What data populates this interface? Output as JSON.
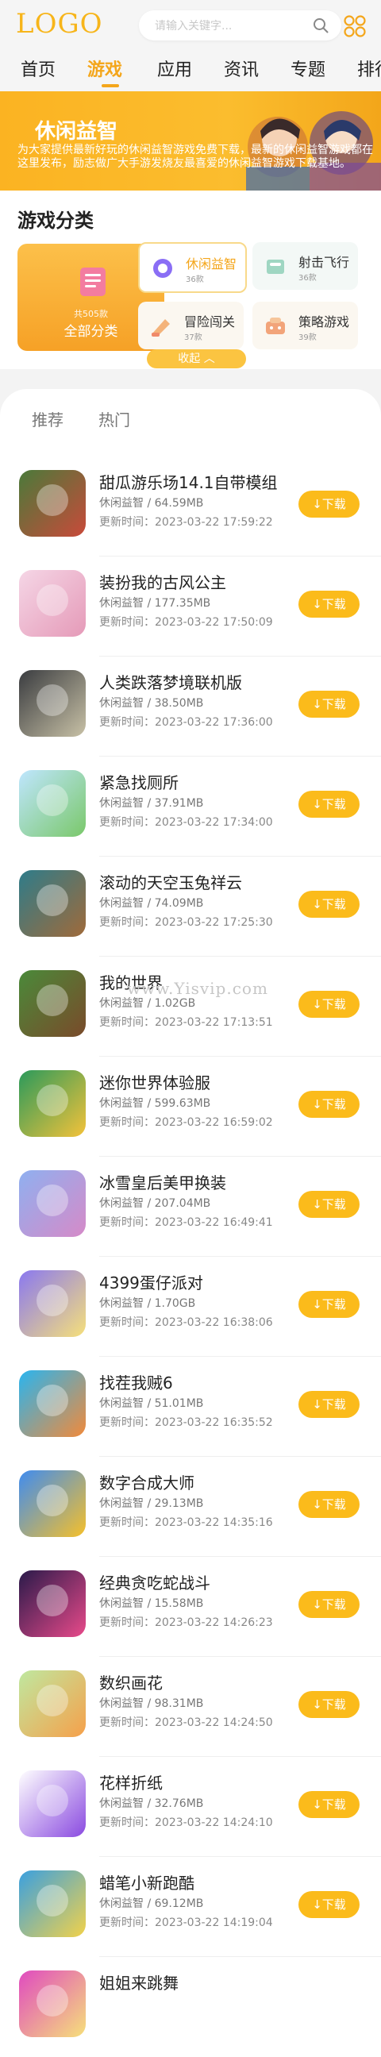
{
  "header": {
    "logo": "LOGO",
    "search_placeholder": "请输入关键字...",
    "nav": [
      "首页",
      "游戏",
      "应用",
      "资讯",
      "专题",
      "排行"
    ]
  },
  "banner": {
    "title": "休闲益智",
    "description": "为大家提供最新好玩的休闲益智游戏免费下载，最新的休闲益智游戏都在这里发布，励志做广大手游发烧友最喜爱的休闲益智游戏下载基地。"
  },
  "category_section": {
    "title": "游戏分类",
    "all": {
      "count": "共505款",
      "label": "全部分类"
    },
    "items": [
      {
        "label": "休闲益智",
        "count": "36款"
      },
      {
        "label": "射击飞行",
        "count": "36款"
      },
      {
        "label": "冒险闯关",
        "count": "37款"
      },
      {
        "label": "策略游戏",
        "count": "39款"
      }
    ],
    "collapse_label": "收起"
  },
  "tabs": [
    "推荐",
    "热门"
  ],
  "download_label": "↓下载",
  "watermark": "www.Yisvip.com",
  "games": [
    {
      "title": "甜瓜游乐场14.1自带模组",
      "meta": "休闲益智 / 64.59MB",
      "time": "更新时间：2023-03-22 17:59:22",
      "icon": "melon-playground-icon",
      "colors": [
        "#4a7a3a",
        "#c94a3a"
      ]
    },
    {
      "title": "装扮我的古风公主",
      "meta": "休闲益智 / 177.35MB",
      "time": "更新时间：2023-03-22 17:50:09",
      "icon": "princess-icon",
      "colors": [
        "#f5d6e6",
        "#e59ab8"
      ]
    },
    {
      "title": "人类跌落梦境联机版",
      "meta": "休闲益智 / 38.50MB",
      "time": "更新时间：2023-03-22 17:36:00",
      "icon": "human-fall-flat-icon",
      "colors": [
        "#3a3c40",
        "#c8c1a6"
      ]
    },
    {
      "title": "紧急找厕所",
      "meta": "休闲益智 / 37.91MB",
      "time": "更新时间：2023-03-22 17:34:00",
      "icon": "toilet-game-icon",
      "colors": [
        "#bfe6ff",
        "#7ac86a"
      ]
    },
    {
      "title": "滚动的天空玉兔祥云",
      "meta": "休闲益智 / 74.09MB",
      "time": "更新时间：2023-03-22 17:25:30",
      "icon": "rolling-sky-icon",
      "colors": [
        "#2e7c8a",
        "#a06a3a"
      ]
    },
    {
      "title": "我的世界",
      "meta": "休闲益智 / 1.02GB",
      "time": "更新时间：2023-03-22 17:13:51",
      "icon": "minecraft-icon",
      "colors": [
        "#4a8a3a",
        "#7a4a2a"
      ]
    },
    {
      "title": "迷你世界体验服",
      "meta": "休闲益智 / 599.63MB",
      "time": "更新时间：2023-03-22 16:59:02",
      "icon": "mini-world-icon",
      "colors": [
        "#2b9a5b",
        "#f4c23a"
      ]
    },
    {
      "title": "冰雪皇后美甲换装",
      "meta": "休闲益智 / 207.04MB",
      "time": "更新时间：2023-03-22 16:49:41",
      "icon": "ice-queen-icon",
      "colors": [
        "#8fb0f0",
        "#d68ac8"
      ]
    },
    {
      "title": "4399蛋仔派对",
      "meta": "休闲益智 / 1.70GB",
      "time": "更新时间：2023-03-22 16:38:06",
      "icon": "eggy-party-icon",
      "colors": [
        "#8a78f0",
        "#f6e07a"
      ]
    },
    {
      "title": "找茬我贼6",
      "meta": "休闲益智 / 51.01MB",
      "time": "更新时间：2023-03-22 16:35:52",
      "icon": "spot-difference-icon",
      "colors": [
        "#29b5f0",
        "#f28a3a"
      ]
    },
    {
      "title": "数字合成大师",
      "meta": "休闲益智 / 29.13MB",
      "time": "更新时间：2023-03-22 14:35:16",
      "icon": "number-merge-icon",
      "colors": [
        "#3f8cf0",
        "#f6c02a"
      ]
    },
    {
      "title": "经典贪吃蛇战斗",
      "meta": "休闲益智 / 15.58MB",
      "time": "更新时间：2023-03-22 14:26:23",
      "icon": "snake-battle-icon",
      "colors": [
        "#2a1a4a",
        "#e84a8a"
      ]
    },
    {
      "title": "数织画花",
      "meta": "休闲益智 / 98.31MB",
      "time": "更新时间：2023-03-22 14:24:50",
      "icon": "flower-puzzle-icon",
      "colors": [
        "#bfe8a0",
        "#f6a04a"
      ]
    },
    {
      "title": "花样折纸",
      "meta": "休闲益智 / 32.76MB",
      "time": "更新时间：2023-03-22 14:24:10",
      "icon": "origami-icon",
      "colors": [
        "#ffffff",
        "#8a4ae0"
      ]
    },
    {
      "title": "蜡笔小新跑酷",
      "meta": "休闲益智 / 69.12MB",
      "time": "更新时间：2023-03-22 14:19:04",
      "icon": "crayon-shin-chan-icon",
      "colors": [
        "#3aa0e0",
        "#f2d24a"
      ]
    },
    {
      "title": "姐姐来跳舞",
      "meta": "",
      "time": "",
      "icon": "dance-game-icon",
      "colors": [
        "#e04ac0",
        "#f6e07a"
      ]
    }
  ]
}
